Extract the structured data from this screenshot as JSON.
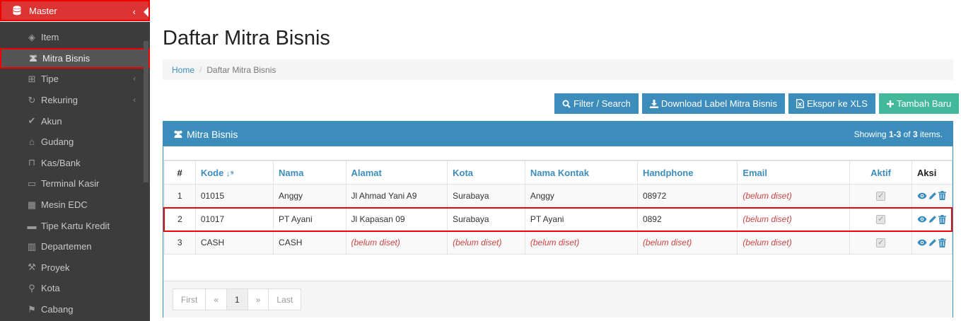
{
  "sidebar": {
    "header": "Master",
    "header_chevron": "‹",
    "items": [
      {
        "label": "Item",
        "icon": "cube-icon"
      },
      {
        "label": "Mitra Bisnis",
        "icon": "users-icon",
        "active": true
      },
      {
        "label": "Tipe",
        "icon": "sitemap-icon",
        "chevron": "‹"
      },
      {
        "label": "Rekuring",
        "icon": "refresh-icon",
        "chevron": "‹"
      },
      {
        "label": "Akun",
        "icon": "check-icon"
      },
      {
        "label": "Gudang",
        "icon": "home-icon"
      },
      {
        "label": "Kas/Bank",
        "icon": "bank-icon"
      },
      {
        "label": "Terminal Kasir",
        "icon": "desktop-icon"
      },
      {
        "label": "Mesin EDC",
        "icon": "calculator-icon"
      },
      {
        "label": "Tipe Kartu Kredit",
        "icon": "credit-card-icon"
      },
      {
        "label": "Departemen",
        "icon": "building-icon"
      },
      {
        "label": "Proyek",
        "icon": "gavel-icon"
      },
      {
        "label": "Kota",
        "icon": "map-marker-icon"
      },
      {
        "label": "Cabang",
        "icon": "flag-icon"
      }
    ]
  },
  "page": {
    "title": "Daftar Mitra Bisnis",
    "breadcrumb": {
      "home": "Home",
      "sep": "/",
      "current": "Daftar Mitra Bisnis"
    }
  },
  "toolbar": {
    "filter": "Filter / Search",
    "download": "Download Label Mitra Bisnis",
    "export": "Ekspor ke XLS",
    "add": "Tambah Baru"
  },
  "panel": {
    "title": "Mitra Bisnis",
    "summary_prefix": "Showing ",
    "summary_range": "1-3",
    "summary_suffix": " of ",
    "summary_total": "3",
    "summary_end": " items."
  },
  "table": {
    "headers": [
      "#",
      "Kode",
      "Nama",
      "Alamat",
      "Kota",
      "Nama Kontak",
      "Handphone",
      "Email",
      "Aktif",
      "Aksi"
    ],
    "rows": [
      {
        "no": "1",
        "kode": "01015",
        "nama": "Anggy",
        "alamat": "Jl Ahmad Yani A9",
        "kota": "Surabaya",
        "kontak": "Anggy",
        "hp": "08972",
        "email": "(belum diset)"
      },
      {
        "no": "2",
        "kode": "01017",
        "nama": "PT Ayani",
        "alamat": "Jl Kapasan 09",
        "kota": "Surabaya",
        "kontak": "PT Ayani",
        "hp": "0892",
        "email": "(belum diset)"
      },
      {
        "no": "3",
        "kode": "CASH",
        "nama": "CASH",
        "alamat": "(belum diset)",
        "kota": "(belum diset)",
        "kontak": "(belum diset)",
        "hp": "(belum diset)",
        "email": "(belum diset)"
      }
    ]
  },
  "pager": {
    "first": "First",
    "prev": "«",
    "current": "1",
    "next": "»",
    "last": "Last"
  },
  "colors": {
    "primary": "#3c8dbc",
    "success": "#44b89b",
    "sidebar": "#3c3c3c",
    "highlight": "#e00000"
  }
}
